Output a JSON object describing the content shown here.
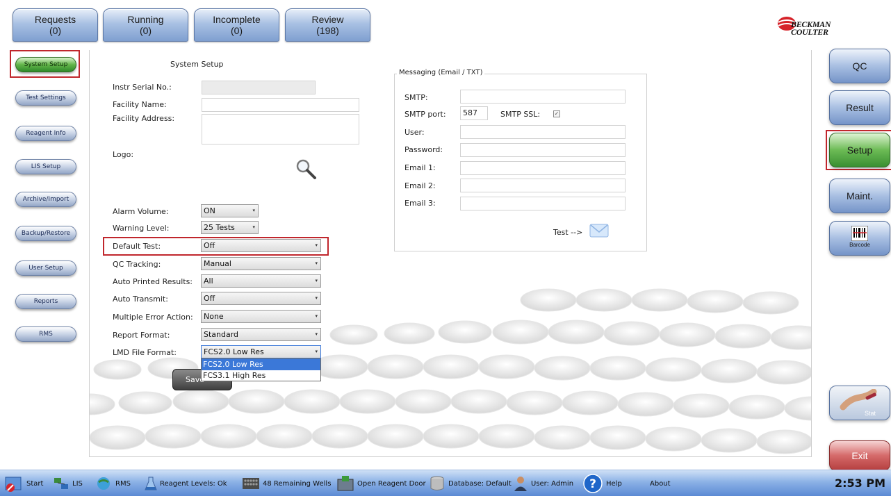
{
  "tabs": [
    {
      "label": "Requests",
      "count": "(0)"
    },
    {
      "label": "Running",
      "count": "(0)"
    },
    {
      "label": "Incomplete",
      "count": "(0)"
    },
    {
      "label": "Review",
      "count": "(198)"
    }
  ],
  "logo": {
    "line1": "BECKMAN",
    "line2": "COULTER"
  },
  "nav": [
    {
      "label": "System Setup"
    },
    {
      "label": "Test Settings"
    },
    {
      "label": "Reagent Info"
    },
    {
      "label": "LIS Setup"
    },
    {
      "label": "Archive/Import"
    },
    {
      "label": "Backup/Restore"
    },
    {
      "label": "User Setup"
    },
    {
      "label": "Reports"
    },
    {
      "label": "RMS"
    }
  ],
  "right_buttons": {
    "qc": "QC",
    "result": "Result",
    "setup": "Setup",
    "maint": "Maint.",
    "barcode": "Barcode",
    "stat": "Stat",
    "exit": "Exit"
  },
  "form": {
    "title": "System Setup",
    "serial_label": "Instr Serial No.:",
    "facility_name_label": "Facility Name:",
    "facility_address_label": "Facility Address:",
    "logo_label": "Logo:",
    "rows": [
      {
        "label": "Alarm Volume:",
        "value": "ON"
      },
      {
        "label": "Warning Level:",
        "value": "25 Tests"
      },
      {
        "label": "Default Test:",
        "value": "Off"
      },
      {
        "label": "QC Tracking:",
        "value": "Manual"
      },
      {
        "label": "Auto Printed Results:",
        "value": "All"
      },
      {
        "label": "Auto Transmit:",
        "value": "Off"
      },
      {
        "label": "Multiple Error Action:",
        "value": "None"
      },
      {
        "label": "Report Format:",
        "value": "Standard"
      },
      {
        "label": "LMD File Format:",
        "value": "FCS2.0 Low Res"
      }
    ],
    "lmd_options": [
      "FCS2.0 Low Res",
      "FCS3.1 High Res"
    ],
    "save_label": "Save"
  },
  "messaging": {
    "title": "Messaging (Email / TXT)",
    "smtp_label": "SMTP:",
    "smtp_port_label": "SMTP port:",
    "smtp_port_value": "587",
    "smtp_ssl_label": "SMTP SSL:",
    "user_label": "User:",
    "password_label": "Password:",
    "email1_label": "Email 1:",
    "email2_label": "Email 2:",
    "email3_label": "Email 3:",
    "test_label": "Test -->"
  },
  "taskbar": {
    "start": "Start",
    "lis": "LIS",
    "rms": "RMS",
    "reagent": "Reagent Levels: Ok",
    "wells": "48 Remaining Wells",
    "door": "Open Reagent Door",
    "database": "Database: Default",
    "user": "User: Admin",
    "help": "Help",
    "about": "About",
    "clock": "2:53 PM"
  }
}
